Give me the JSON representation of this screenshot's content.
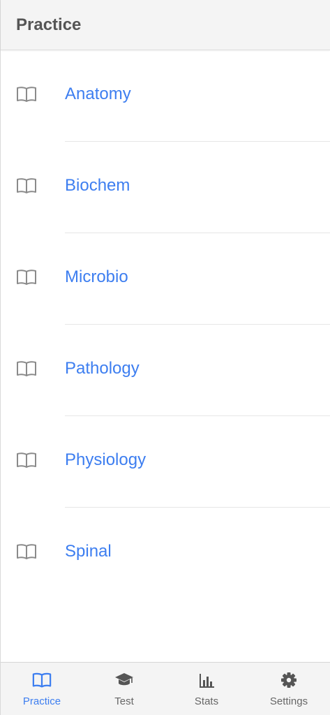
{
  "header": {
    "title": "Practice"
  },
  "colors": {
    "accent": "#3d7ef0",
    "inactive": "#666666",
    "header_bg": "#f4f4f4"
  },
  "subjects": [
    {
      "label": "Anatomy",
      "icon": "book-icon"
    },
    {
      "label": "Biochem",
      "icon": "book-icon"
    },
    {
      "label": "Microbio",
      "icon": "book-icon"
    },
    {
      "label": "Pathology",
      "icon": "book-icon"
    },
    {
      "label": "Physiology",
      "icon": "book-icon"
    },
    {
      "label": "Spinal",
      "icon": "book-icon"
    }
  ],
  "tabbar": {
    "tabs": [
      {
        "label": "Practice",
        "icon": "book-icon",
        "active": true
      },
      {
        "label": "Test",
        "icon": "graduation-cap-icon",
        "active": false
      },
      {
        "label": "Stats",
        "icon": "bar-chart-icon",
        "active": false
      },
      {
        "label": "Settings",
        "icon": "gear-icon",
        "active": false
      }
    ]
  }
}
